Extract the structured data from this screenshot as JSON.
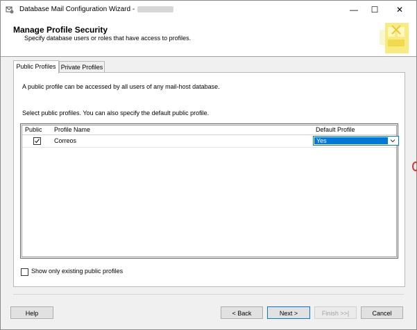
{
  "window": {
    "title": "Database Mail Configuration Wizard -",
    "minimize_glyph": "—",
    "maximize_glyph": "☐",
    "close_glyph": "✕"
  },
  "header": {
    "title": "Manage Profile Security",
    "subtitle": "Specify database users or roles that have access to profiles."
  },
  "tabs": [
    {
      "label": "Public Profiles",
      "active": true
    },
    {
      "label": "Private Profiles",
      "active": false
    }
  ],
  "panel": {
    "description": "A public profile can be accessed by all users of any mail-host database.",
    "instruction": "Select public profiles. You can also specify the default public profile."
  },
  "grid": {
    "columns": [
      "Public",
      "Profile Name",
      "Default Profile"
    ],
    "rows": [
      {
        "public": true,
        "profile_name": "Correos",
        "default_profile": "Yes"
      }
    ]
  },
  "show_existing": {
    "label": "Show only existing public profiles",
    "checked": false
  },
  "buttons": {
    "help": "Help",
    "back": "< Back",
    "next": "Next >",
    "finish": "Finish >>|",
    "cancel": "Cancel"
  },
  "colors": {
    "accent": "#0078d7",
    "header_bg": "#ffffff",
    "dialog_bg": "#f0f0f0"
  },
  "icons": {
    "app": "database-mail-icon",
    "header_graphic": "mail-envelope-icon",
    "dropdown": "chevron-down-icon",
    "checkmark": "checkmark-icon"
  }
}
